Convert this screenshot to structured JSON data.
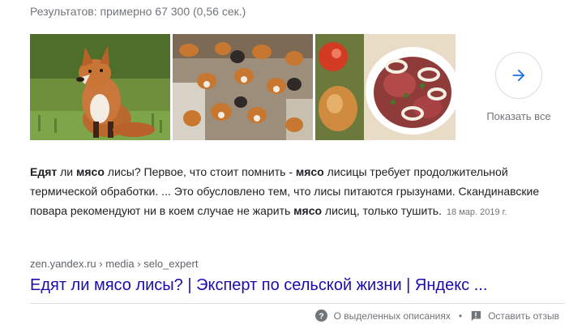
{
  "results_stats": "Результатов: примерно 67 300 (0,56 сек.)",
  "images": [
    {
      "icon": "fox-sitting-on-grass-image"
    },
    {
      "icon": "foxes-group-top-view-image"
    },
    {
      "icon": "raw-meat-with-onions-image"
    }
  ],
  "show_all": {
    "label": "Показать все",
    "icon": "arrow-right-icon"
  },
  "snippet": {
    "p1_bold": "Едят",
    "p2": " ли ",
    "p3_bold": "мясо",
    "p4": " лисы? Первое, что стоит помнить - ",
    "p5_bold": "мясо",
    "p6": " лисицы требует продолжительной термической обработки. ... Это обусловлено тем, что лисы питаются грызунами. Скандинавские повара рекомендуют ни в коем случае не жарить ",
    "p7_bold": "мясо",
    "p8": " лисиц, только тушить.",
    "date": "18 мар. 2019 г."
  },
  "source": {
    "domain": "zen.yandex.ru",
    "sep1": " › ",
    "path1": "media",
    "sep2": " › ",
    "path2": "selo_expert"
  },
  "result_title": "Едят ли мясо лисы? | Эксперт по сельской жизни | Яндекс ...",
  "footer": {
    "about_label": "О выделенных описаниях",
    "about_icon": "help-circle-icon",
    "separator": "•",
    "feedback_label": "Оставить отзыв",
    "feedback_icon": "feedback-icon"
  },
  "colors": {
    "link": "#1a0dab",
    "muted": "#70757a",
    "text": "#202124",
    "arrow": "#1a73e8"
  }
}
